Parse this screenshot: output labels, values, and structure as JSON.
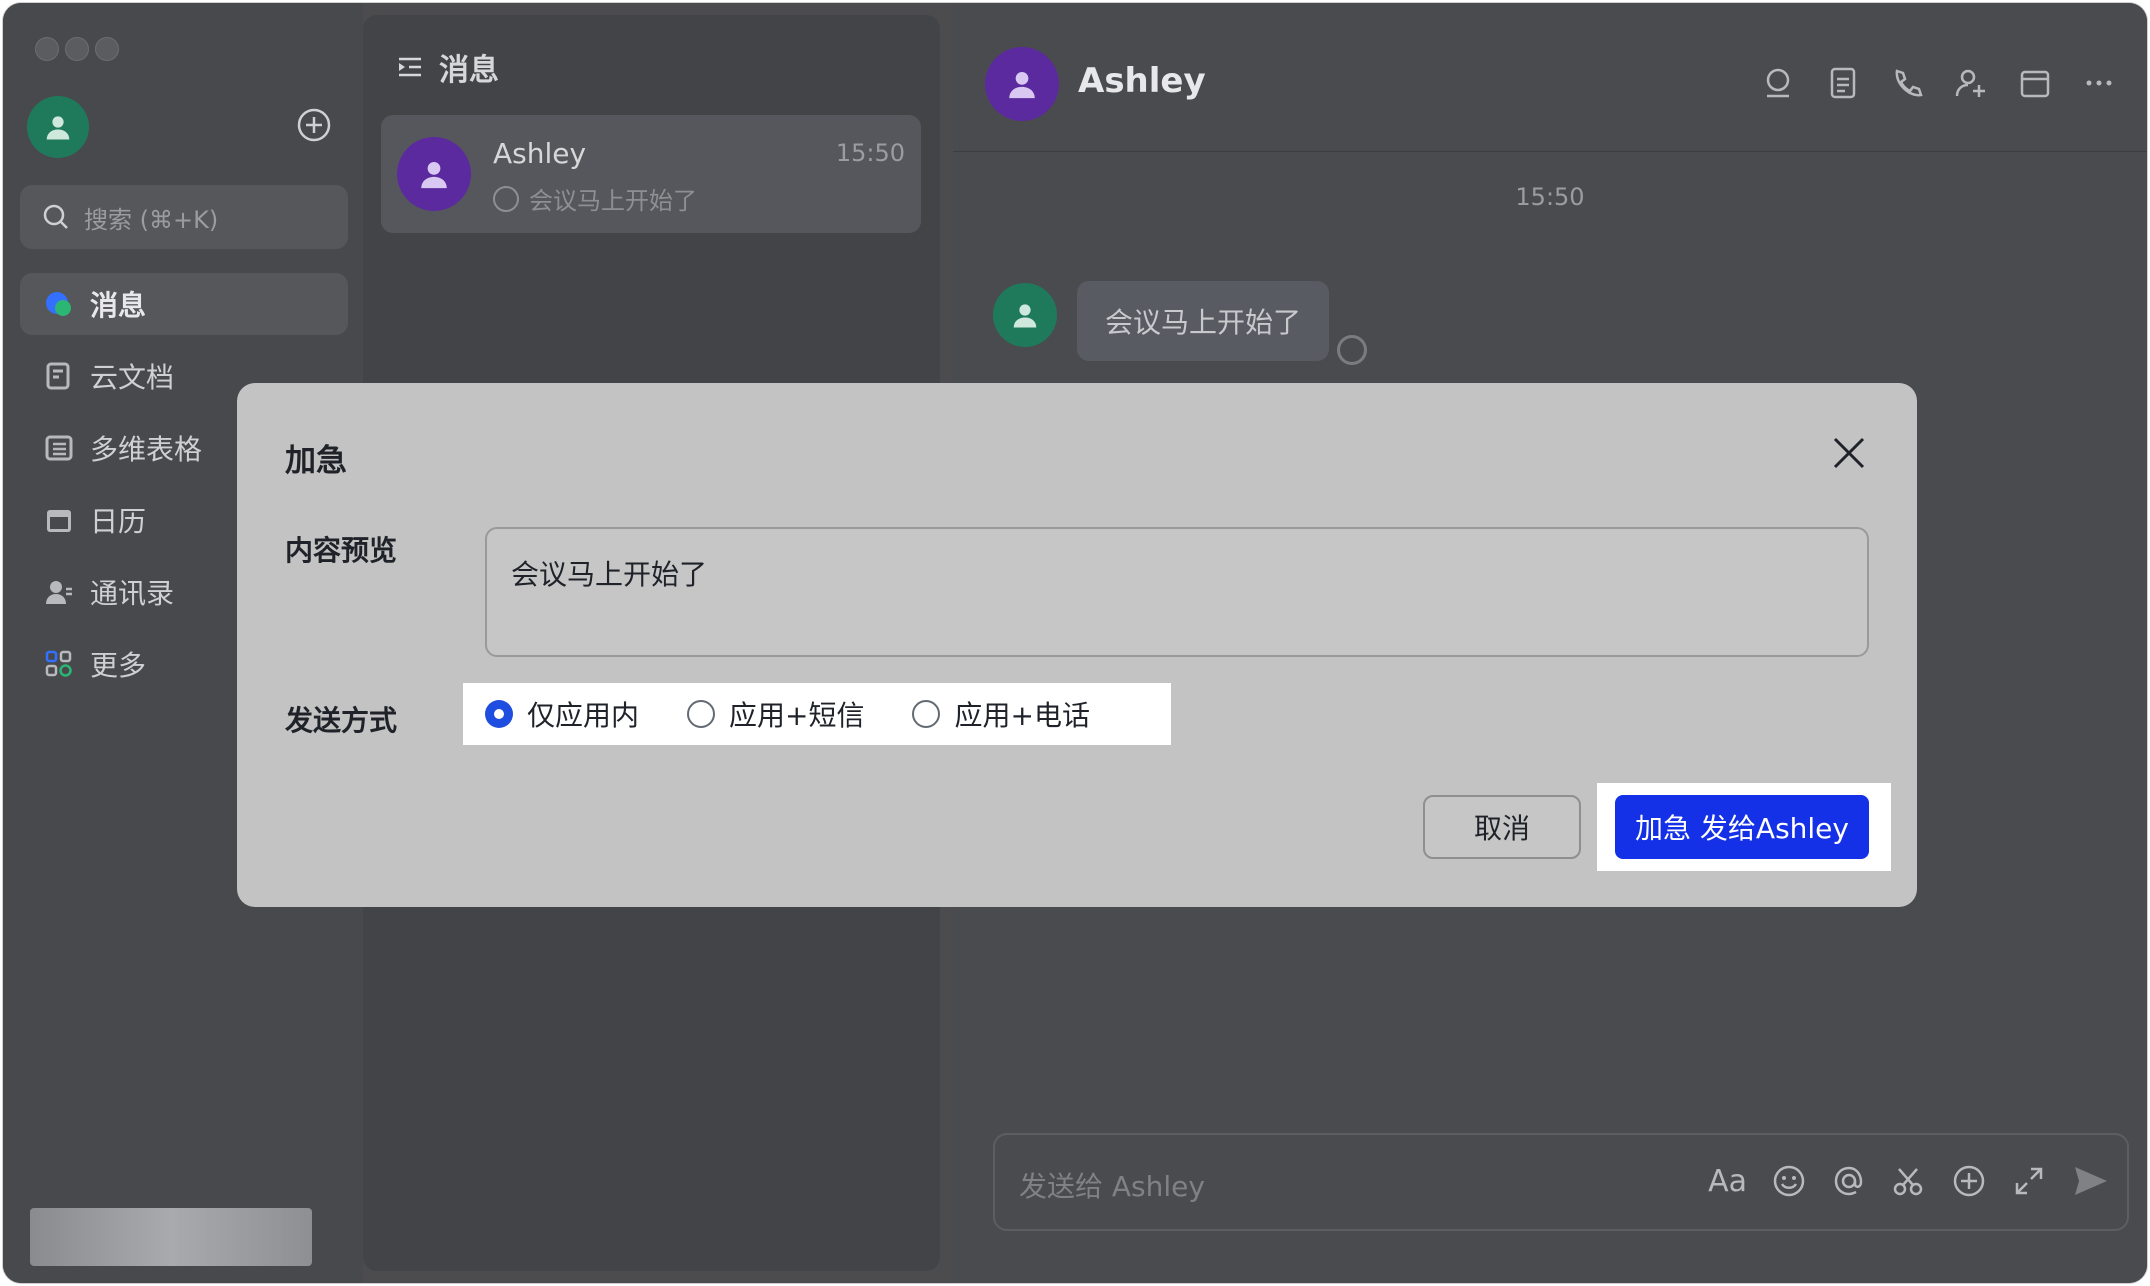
{
  "sidebar": {
    "search_placeholder": "搜索 (⌘+K)",
    "items": [
      {
        "label": "消息",
        "icon": "messages-icon",
        "active": true
      },
      {
        "label": "云文档",
        "icon": "docs-icon"
      },
      {
        "label": "多维表格",
        "icon": "base-icon"
      },
      {
        "label": "日历",
        "icon": "calendar-icon"
      },
      {
        "label": "通讯录",
        "icon": "contacts-icon"
      },
      {
        "label": "更多",
        "icon": "more-apps-icon"
      }
    ]
  },
  "middle": {
    "title": "消息",
    "chats": [
      {
        "name": "Ashley",
        "time": "15:50",
        "preview": "会议马上开始了"
      }
    ]
  },
  "chat": {
    "name": "Ashley",
    "timestamp": "15:50",
    "message": "会议马上开始了",
    "composer_placeholder": "发送给 Ashley",
    "format_label": "Aa"
  },
  "dialog": {
    "title": "加急",
    "preview_label": "内容预览",
    "preview_text": "会议马上开始了",
    "method_label": "发送方式",
    "options": [
      "仅应用内",
      "应用+短信",
      "应用+电话"
    ],
    "selected_option": "仅应用内",
    "cancel_label": "取消",
    "confirm_label": "加急 发给Ashley"
  },
  "colors": {
    "accent": "#1431e8",
    "avatar_purple": "#5b2a9e",
    "avatar_green": "#1f7a5c"
  }
}
